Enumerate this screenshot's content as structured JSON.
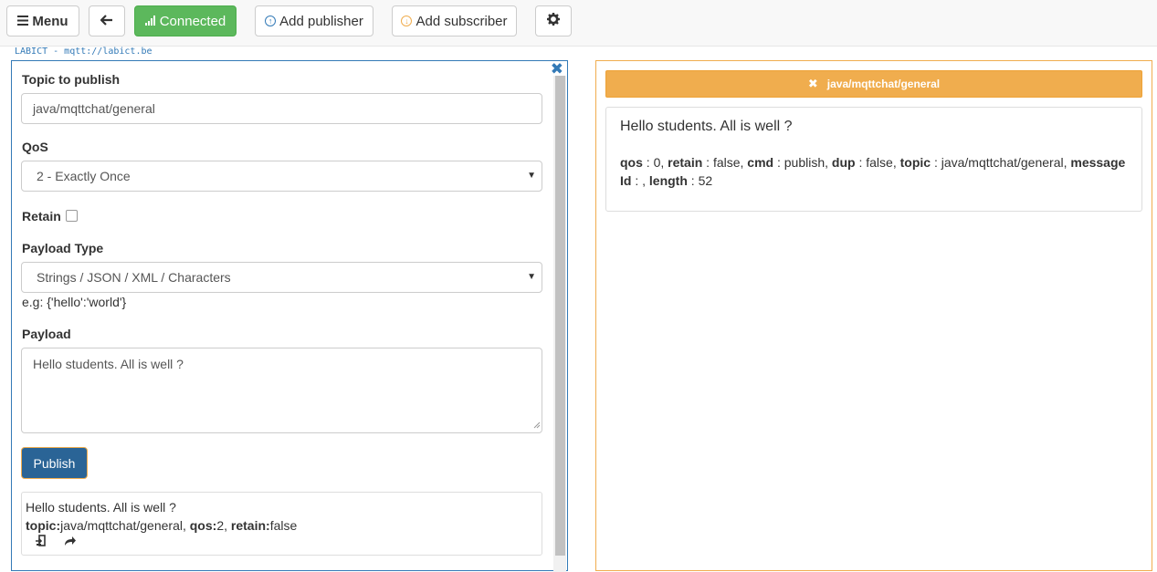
{
  "toolbar": {
    "menu_label": "Menu",
    "connected_label": "Connected",
    "add_publisher_label": "Add publisher",
    "add_subscriber_label": "Add subscriber",
    "connected_color": "#5cb85c"
  },
  "broker": {
    "label": "LABICT - mqtt://labict.be"
  },
  "publisher": {
    "topic_label": "Topic to publish",
    "topic_value": "java/mqttchat/general",
    "qos_label": "QoS",
    "qos_value": "2 - Exactly Once",
    "retain_label": "Retain",
    "retain_checked": false,
    "payload_type_label": "Payload Type",
    "payload_type_value": "Strings / JSON / XML / Characters",
    "payload_hint": "e.g: {'hello':'world'}",
    "payload_label": "Payload",
    "payload_value": "Hello students. All is well ?",
    "publish_label": "Publish",
    "history": {
      "message": "Hello students. All is well ?",
      "topic_key": "topic:",
      "topic_val": "java/mqttchat/general",
      "qos_key": "qos:",
      "qos_val": "2",
      "retain_key": "retain:",
      "retain_val": "false"
    }
  },
  "subscriber": {
    "topic": "java/mqttchat/general",
    "accent_color": "#f0ad4e",
    "message": {
      "payload": "Hello students. All is well ?",
      "qos_key": "qos",
      "qos_val": "0",
      "retain_key": "retain",
      "retain_val": "false",
      "cmd_key": "cmd",
      "cmd_val": "publish",
      "dup_key": "dup",
      "dup_val": "false",
      "topic_key": "topic",
      "topic_val": "java/mqttchat/general",
      "msgid_key": "message Id",
      "msgid_val": "",
      "length_key": "length",
      "length_val": "52"
    }
  }
}
